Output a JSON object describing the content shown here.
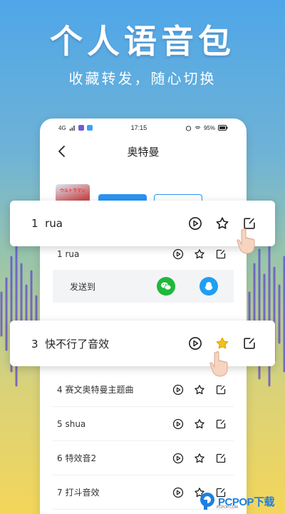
{
  "banner": {
    "headline": "个人语音包",
    "subline": "收藏转发，随心切换"
  },
  "statusbar": {
    "left_text": "4G",
    "time": "17:15",
    "battery": "95%"
  },
  "nav": {
    "title": "奥特曼",
    "back_icon": "chevron-left-icon"
  },
  "album": {
    "cover_text": "ウルトラマン"
  },
  "popups": [
    {
      "index": "1",
      "title": "rua",
      "highlight_star": false
    },
    {
      "index": "3",
      "title": "快不行了音效",
      "highlight_star": true
    }
  ],
  "list": [
    {
      "index": "1",
      "title": "rua"
    },
    {
      "index": "4",
      "title": "赛文奥特曼主题曲"
    },
    {
      "index": "5",
      "title": "shua"
    },
    {
      "index": "6",
      "title": "特效音2"
    },
    {
      "index": "7",
      "title": "打斗音效"
    }
  ],
  "send_panel": {
    "label": "发送到",
    "targets": [
      "wechat-icon",
      "qq-icon"
    ]
  },
  "watermark": {
    "brand": "PCPOP下载",
    "tagline": "PCPOP.COM"
  },
  "colors": {
    "accent_blue": "#2a93f0",
    "wechat_green": "#1fb83a",
    "qq_blue": "#1e9ff2",
    "star_gold": "#f2c21b"
  }
}
